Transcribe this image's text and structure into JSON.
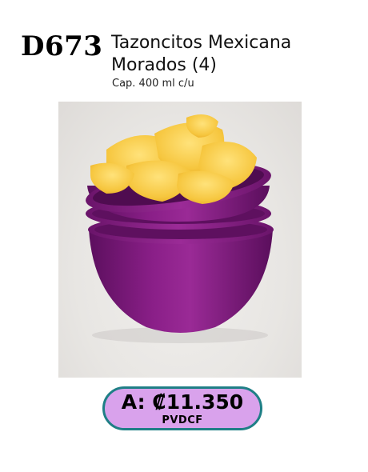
{
  "product": {
    "code": "D673",
    "title_line1": "Tazoncitos Mexicana",
    "title_line2": "Morados (4)",
    "capacity": "Cap. 400 ml c/u"
  },
  "price": {
    "label": "A: ₡11.350",
    "note": "PVDCF"
  },
  "image": {
    "description_icon": "purple-bowls-with-chips-photo"
  },
  "colors": {
    "bowl": "#7a1a78",
    "pill_fill": "#d9a2ec",
    "pill_border": "#1f7f86"
  }
}
